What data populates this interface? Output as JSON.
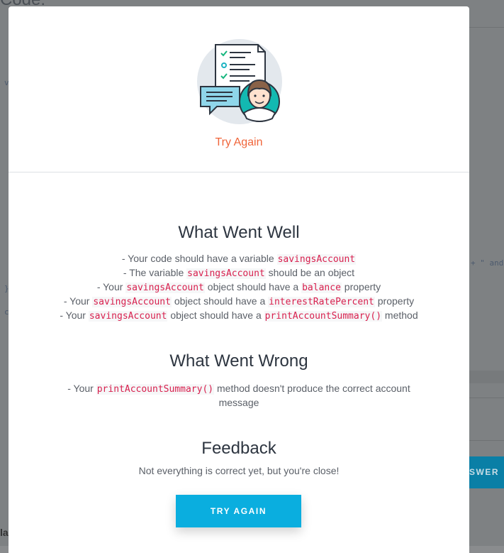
{
  "background": {
    "page_title": "Code:",
    "answer_button_label": "SWER",
    "bottom_text": "la",
    "code_fragment_right": "+ \"  and",
    "frag_v": "v",
    "frag_brace": "}",
    "frag_c": "c"
  },
  "modal": {
    "status_title": "Try Again",
    "sections": {
      "well": {
        "heading": "What Went Well",
        "items": [
          {
            "pre": "- Your code should have a variable ",
            "code1": "savingsAccount",
            "mid": "",
            "code2": "",
            "post": ""
          },
          {
            "pre": "- The variable ",
            "code1": "savingsAccount",
            "mid": " should be an object",
            "code2": "",
            "post": ""
          },
          {
            "pre": "- Your ",
            "code1": "savingsAccount",
            "mid": " object should have a ",
            "code2": "balance",
            "post": " property"
          },
          {
            "pre": "- Your ",
            "code1": "savingsAccount",
            "mid": " object should have a ",
            "code2": "interestRatePercent",
            "post": " property"
          },
          {
            "pre": "- Your ",
            "code1": "savingsAccount",
            "mid": " object should have a ",
            "code2": "printAccountSummary()",
            "post": " method"
          }
        ]
      },
      "wrong": {
        "heading": "What Went Wrong",
        "item_pre": "- Your ",
        "item_code": "printAccountSummary()",
        "item_post": " method doesn't produce the correct account message"
      },
      "feedback": {
        "heading": "Feedback",
        "text": "Not everything is correct yet, but you're close!"
      }
    },
    "button_label": "TRY AGAIN"
  },
  "colors": {
    "accent": "#0aaedf",
    "status": "#f0653a",
    "code": "#d8204e"
  }
}
